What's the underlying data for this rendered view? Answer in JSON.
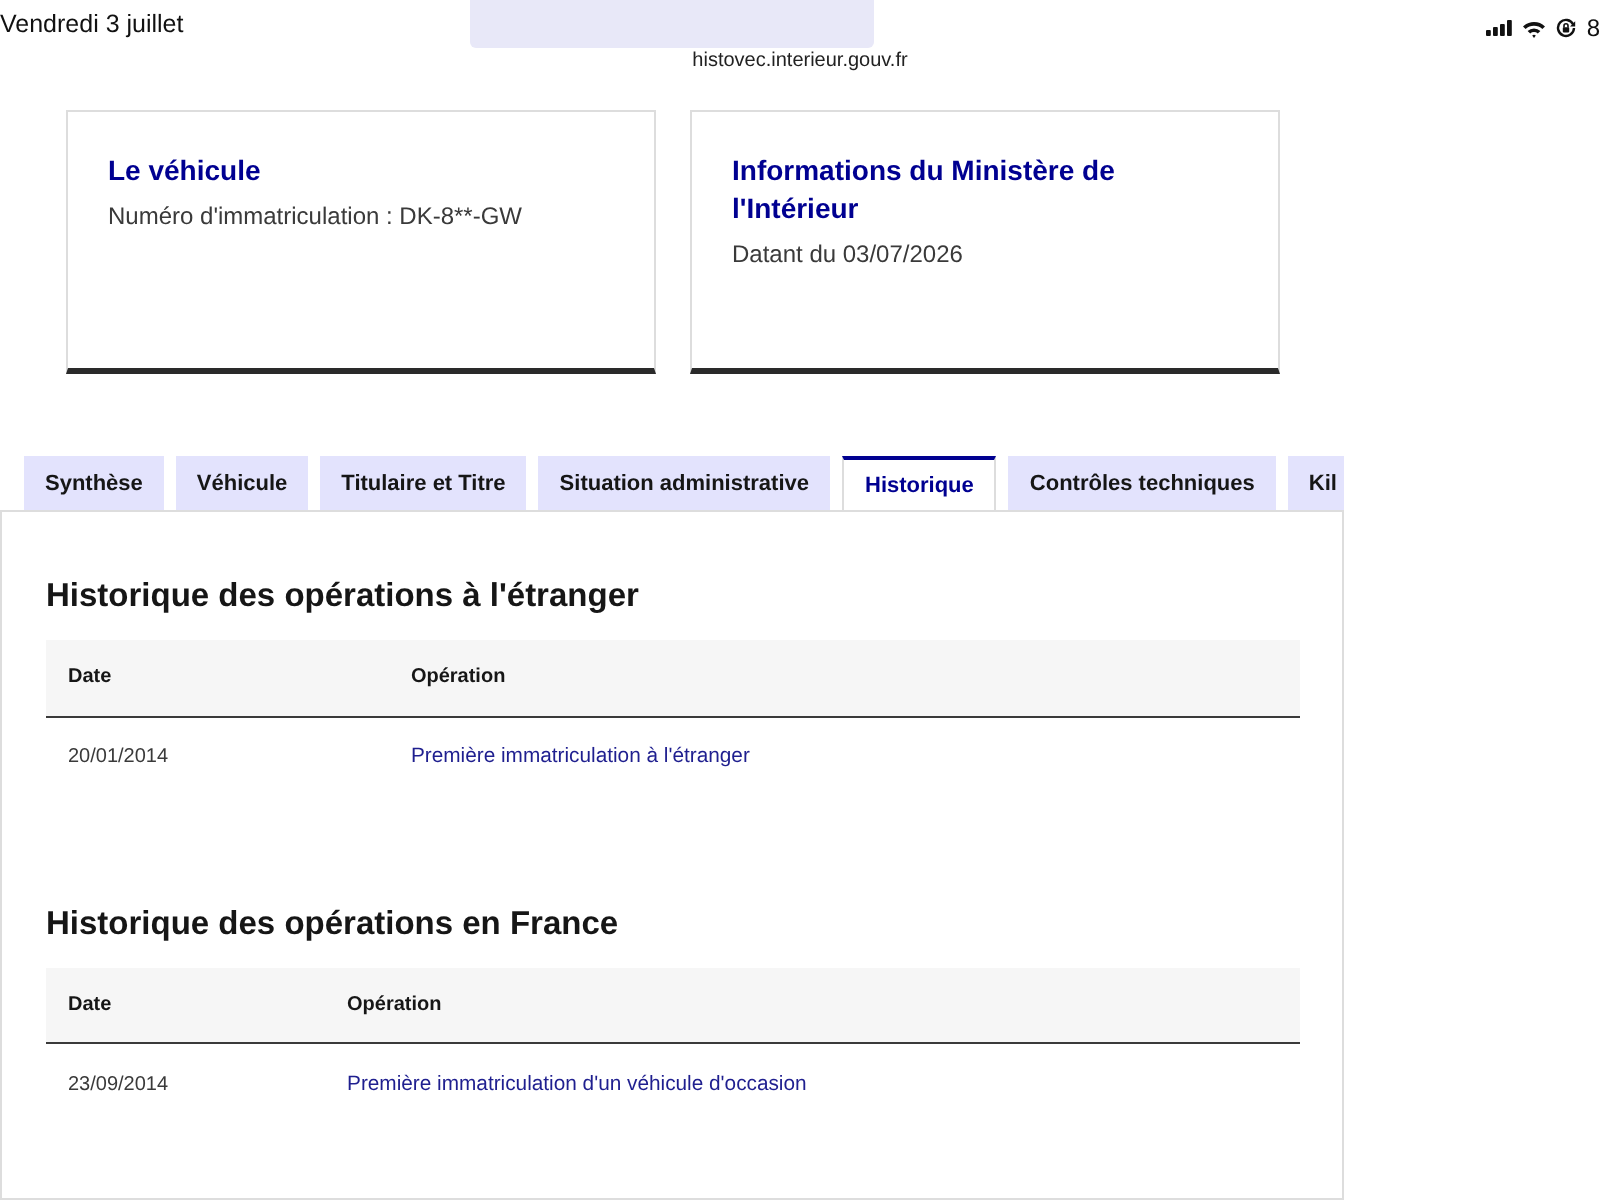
{
  "status_bar": {
    "date": "Vendredi 3 juillet",
    "url": "histovec.interieur.gouv.fr",
    "battery": "8"
  },
  "cards": [
    {
      "title": "Le véhicule",
      "text": "Numéro d'immatriculation : DK-8**-GW"
    },
    {
      "title": "Informations du Ministère de l'Intérieur",
      "text": "Datant du 03/07/2026"
    }
  ],
  "tabs": [
    {
      "label": "Synthèse",
      "selected": false
    },
    {
      "label": "Véhicule",
      "selected": false
    },
    {
      "label": "Titulaire et Titre",
      "selected": false
    },
    {
      "label": "Situation administrative",
      "selected": false
    },
    {
      "label": "Historique",
      "selected": true
    },
    {
      "label": "Contrôles techniques",
      "selected": false
    },
    {
      "label": "Kil",
      "selected": false
    }
  ],
  "sections": [
    {
      "title": "Historique des opérations à l'étranger",
      "table": {
        "columns": [
          "Date",
          "Opération"
        ],
        "rows": [
          [
            "20/01/2014",
            "Première immatriculation à l'étranger"
          ]
        ]
      }
    },
    {
      "title": "Historique des opérations en France",
      "table": {
        "columns": [
          "Date",
          "Opération"
        ],
        "rows": [
          [
            "23/09/2014",
            "Première immatriculation d'un véhicule d'occasion"
          ]
        ]
      }
    }
  ]
}
